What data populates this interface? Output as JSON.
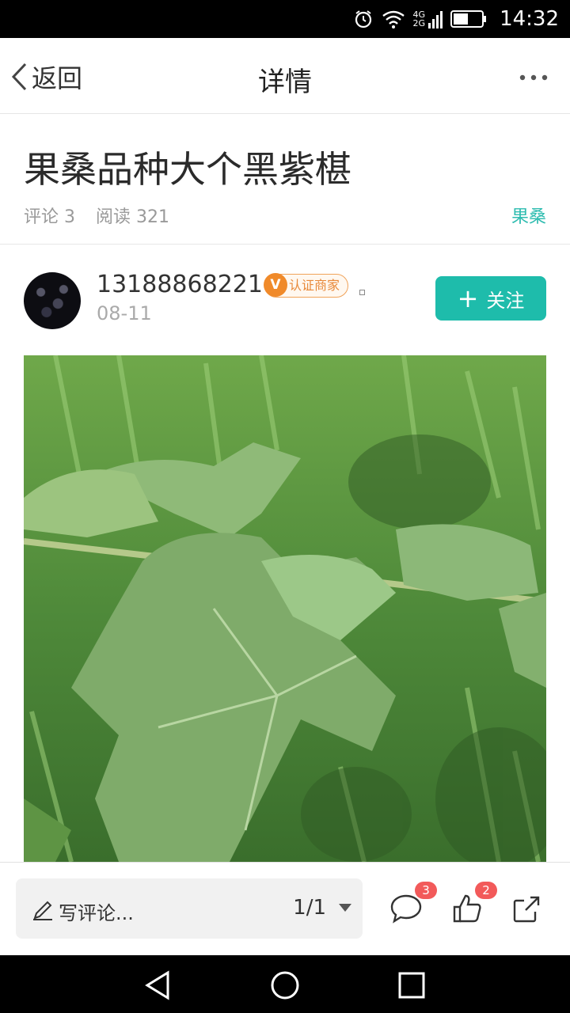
{
  "status": {
    "net_top": "4G",
    "net_bottom": "2G",
    "time": "14:32"
  },
  "nav": {
    "back_label": "返回",
    "title": "详情"
  },
  "post": {
    "title": "果桑品种大个黑紫椹",
    "comments_label": "评论 3",
    "reads_label": "阅读 321",
    "category": "果桑"
  },
  "author": {
    "name": "13188868221",
    "badge_letter": "V",
    "badge_label": "认证商家",
    "date": "08-11",
    "follow_label": "关注"
  },
  "bottom": {
    "comment_placeholder": "写评论...",
    "page_indicator": "1/1",
    "comment_count": "3",
    "like_count": "2"
  },
  "colors": {
    "accent": "#1ebcab",
    "badge": "#f08a2a",
    "count_bubble": "#f25a5a"
  }
}
